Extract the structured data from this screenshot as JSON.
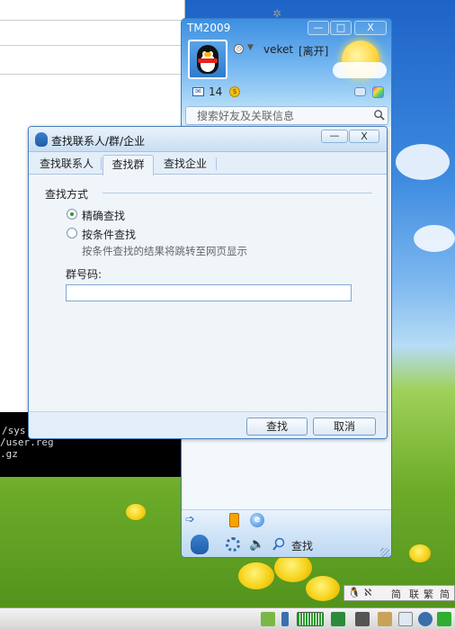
{
  "colors": {
    "accent": "#3d8fe0",
    "dialog_border": "#4a7fbf",
    "radio_checked": "#2a9a2a"
  },
  "background_terminal": {
    "lines": [
      "/sys",
      "/user.reg",
      ".gz"
    ]
  },
  "qq_main": {
    "title": "TM2009",
    "minimize_label": "—",
    "maximize_label": "□",
    "close_label": "X",
    "nickname": "veket",
    "status": "[离开]",
    "mail_count": "14",
    "search_placeholder": "搜索好友及关联信息",
    "bottom_find_label": "查找",
    "icons": [
      "penguin-avatar-icon",
      "clock-icon",
      "caret-down-icon",
      "mail-icon",
      "money-bag-icon",
      "message-icon",
      "color-palette-icon",
      "search-icon",
      "arrow-icon",
      "phone-icon",
      "ie-icon",
      "qq-menu-icon",
      "gear-icon",
      "speaker-icon",
      "find-icon"
    ]
  },
  "find_dialog": {
    "title": "查找联系人/群/企业",
    "minimize_label": "—",
    "close_label": "X",
    "tabs": [
      {
        "label": "查找联系人",
        "active": false
      },
      {
        "label": "查找群",
        "active": true
      },
      {
        "label": "查找企业",
        "active": false
      }
    ],
    "section_label": "查找方式",
    "options": [
      {
        "label": "精确查找",
        "checked": true
      },
      {
        "label": "按条件查找",
        "checked": false
      }
    ],
    "hint": "按条件查找的结果将跳转至网页显示",
    "field_label": "群号码:",
    "field_value": "",
    "find_button": "查找",
    "cancel_button": "取消"
  },
  "tray": {
    "items": [
      "简",
      "联",
      "繁",
      "简"
    ]
  }
}
